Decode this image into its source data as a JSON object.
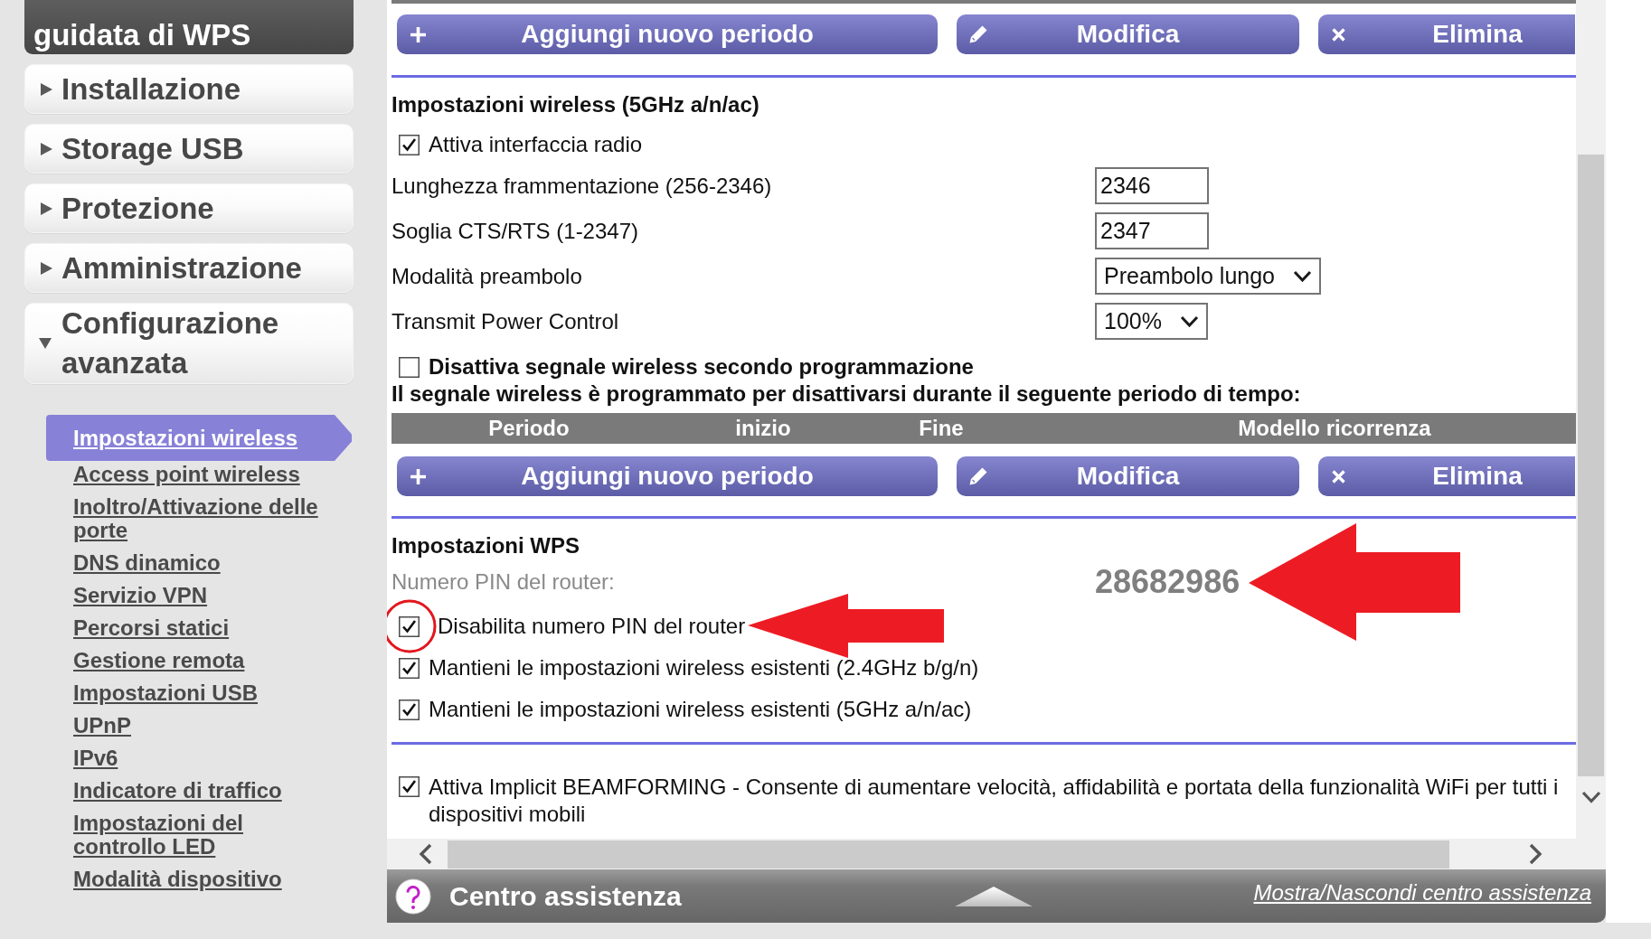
{
  "sidebar": {
    "wizard": {
      "label": "guidata di WPS"
    },
    "menu": [
      {
        "label": "Installazione",
        "expanded": false
      },
      {
        "label": "Storage USB",
        "expanded": false
      },
      {
        "label": "Protezione",
        "expanded": false
      },
      {
        "label": "Amministrazione",
        "expanded": false
      },
      {
        "label": "Configurazione avanzata",
        "expanded": true,
        "children": [
          {
            "label": "Impostazioni wireless",
            "selected": true
          },
          {
            "label": "Access point wireless",
            "selected": false
          },
          {
            "label": "Inoltro/Attivazione delle porte",
            "selected": false
          },
          {
            "label": "DNS dinamico",
            "selected": false
          },
          {
            "label": "Servizio VPN",
            "selected": false
          },
          {
            "label": "Percorsi statici",
            "selected": false
          },
          {
            "label": "Gestione remota",
            "selected": false
          },
          {
            "label": "Impostazioni USB",
            "selected": false
          },
          {
            "label": "UPnP",
            "selected": false
          },
          {
            "label": "IPv6",
            "selected": false
          },
          {
            "label": "Indicatore di traffico",
            "selected": false
          },
          {
            "label": "Impostazioni del controllo LED",
            "selected": false
          },
          {
            "label": "Modalità dispositivo",
            "selected": false
          }
        ]
      }
    ]
  },
  "top_buttons": [
    {
      "kind": "add",
      "label": "Aggiungi nuovo periodo"
    },
    {
      "kind": "edit",
      "label": "Modifica"
    },
    {
      "kind": "delete",
      "label": "Elimina"
    }
  ],
  "wireless_5ghz": {
    "heading": "Impostazioni wireless (5GHz a/n/ac)",
    "enable_radio": {
      "label": "Attiva interfaccia radio",
      "checked": true
    },
    "fields": [
      {
        "kind": "input",
        "label": "Lunghezza frammentazione (256-2346)",
        "value": "2346"
      },
      {
        "kind": "input",
        "label": "Soglia CTS/RTS (1-2347)",
        "value": "2347"
      },
      {
        "kind": "select",
        "label": "Modalità preambolo",
        "value": "Preambolo lungo"
      },
      {
        "kind": "select",
        "label": "Transmit Power Control",
        "value": "100%"
      }
    ],
    "schedule_toggle": {
      "label": "Disattiva segnale wireless secondo programmazione",
      "checked": false
    },
    "schedule_note": "Il segnale wireless è programmato per disattivarsi durante il seguente periodo di tempo:",
    "schedule_table": {
      "columns": [
        "Periodo",
        "inizio",
        "Fine",
        "Modello ricorrenza"
      ]
    },
    "schedule_buttons": [
      {
        "kind": "add",
        "label": "Aggiungi nuovo periodo"
      },
      {
        "kind": "edit",
        "label": "Modifica"
      },
      {
        "kind": "delete",
        "label": "Elimina"
      }
    ]
  },
  "wps": {
    "heading": "Impostazioni WPS",
    "pin_label": "Numero PIN del router:",
    "pin": "28682986",
    "pin_highlighted": true,
    "options": [
      {
        "label": "Disabilita numero PIN del router",
        "checked": true,
        "highlighted": true
      },
      {
        "label": "Mantieni le impostazioni wireless esistenti (2.4GHz b/g/n)",
        "checked": true,
        "highlighted": false
      },
      {
        "label": "Mantieni le impostazioni wireless esistenti (5GHz a/n/ac)",
        "checked": true,
        "highlighted": false
      }
    ]
  },
  "beamforming": {
    "label": "Attiva Implicit BEAMFORMING - Consente di aumentare velocità, affidabilità e portata della funzionalità WiFi per tutti i dispositivi mobili",
    "checked": true
  },
  "help_bar": {
    "title": "Centro assistenza",
    "link": "Mostra/Nascondi centro assistenza"
  }
}
